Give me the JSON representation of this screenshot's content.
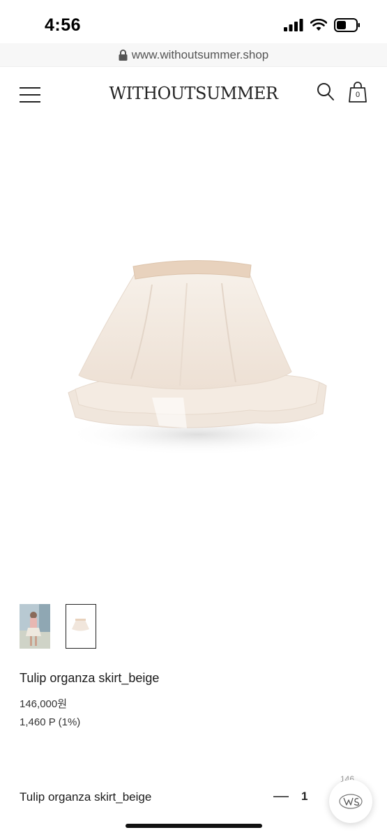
{
  "status_bar": {
    "time": "4:56",
    "icons": [
      "signal-icon",
      "wifi-icon",
      "battery-icon"
    ]
  },
  "browser": {
    "url": "www.withoutsummer.shop",
    "icon": "lock-icon"
  },
  "header": {
    "brand": "WITHOUTSUMMER",
    "menu_icon": "hamburger-menu-icon",
    "search_icon": "search-icon",
    "cart_icon": "shopping-bag-icon",
    "cart_count": "0"
  },
  "product": {
    "image_subject": "skirt",
    "thumbnails": [
      {
        "name": "model-photo",
        "active": false
      },
      {
        "name": "skirt-photo",
        "active": true
      }
    ],
    "name": "Tulip organza skirt_beige",
    "price": "146,000원",
    "points": "1,460 P (1%)"
  },
  "order_bar": {
    "name": "Tulip organza skirt_beige",
    "minus_label": "—",
    "quantity": "1",
    "peek_text": "146"
  },
  "colors": {
    "text": "#1a1a1a",
    "url_bar_bg": "#f7f7f7",
    "skirt": "#f3e9e0",
    "waistband": "#e8d2bd"
  }
}
